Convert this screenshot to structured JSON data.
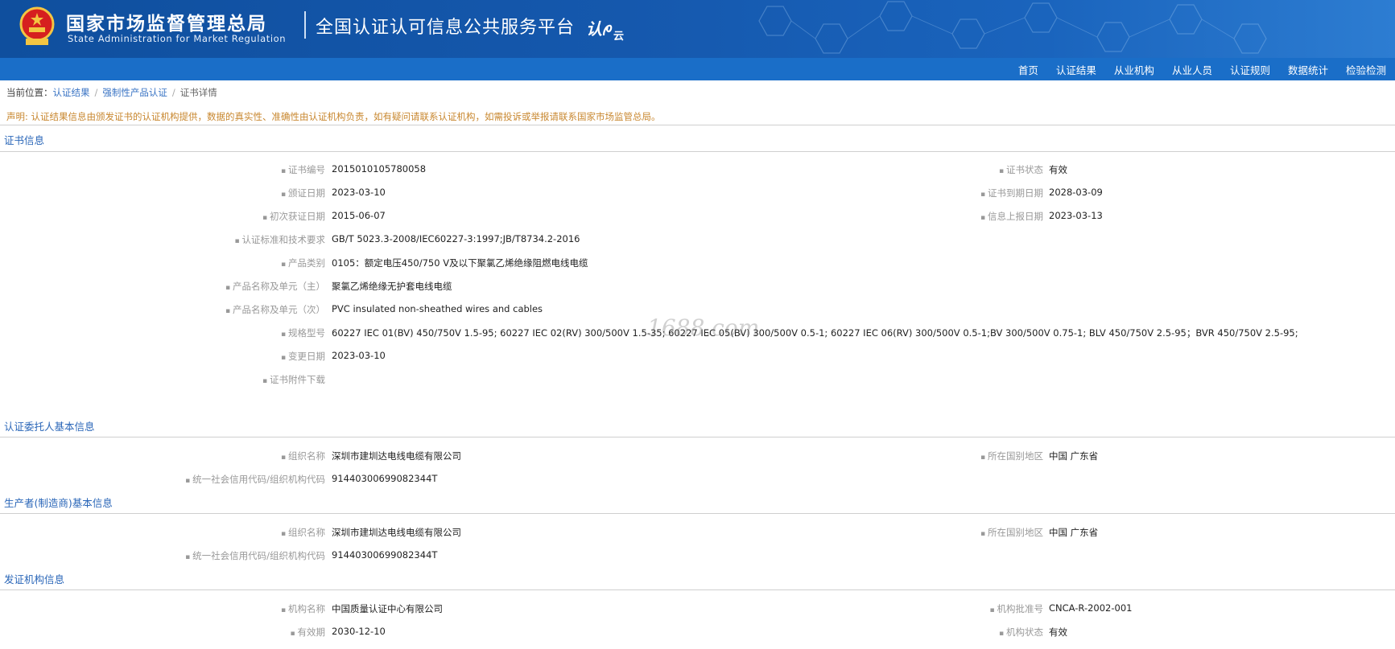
{
  "header": {
    "org_name": "国家市场监督管理总局",
    "org_name_en": "State Administration  for  Market Regulation",
    "platform_title": "全国认证认可信息公共服务平台",
    "logo_text": "认",
    "logo_sub": "云"
  },
  "nav": {
    "items": [
      "首页",
      "认证结果",
      "从业机构",
      "从业人员",
      "认证规则",
      "数据统计",
      "检验检测"
    ]
  },
  "breadcrumb": {
    "prefix": "当前位置：",
    "items": [
      "认证结果",
      "强制性产品认证"
    ],
    "current": "证书详情"
  },
  "notice": "声明: 认证结果信息由颁发证书的认证机构提供，数据的真实性、准确性由认证机构负责，如有疑问请联系认证机构，如需投诉或举报请联系国家市场监管总局。",
  "watermark": "1688.com",
  "sections": {
    "certificate": {
      "title": "证书信息",
      "left": [
        {
          "label": "证书编号",
          "value": "2015010105780058"
        },
        {
          "label": "颁证日期",
          "value": "2023-03-10"
        },
        {
          "label": "初次获证日期",
          "value": "2015-06-07"
        },
        {
          "label": "认证标准和技术要求",
          "value": "GB/T 5023.3-2008/IEC60227-3:1997;JB/T8734.2-2016"
        },
        {
          "label": "产品类别",
          "value": "0105：额定电压450/750 V及以下聚氯乙烯绝缘阻燃电线电缆"
        },
        {
          "label": "产品名称及单元（主）",
          "value": "聚氯乙烯绝缘无护套电线电缆"
        },
        {
          "label": "产品名称及单元（次）",
          "value": "PVC insulated non-sheathed wires and cables"
        },
        {
          "label": "规格型号",
          "value": "60227 IEC 01(BV) 450/750V 1.5-95; 60227 IEC 02(RV) 300/500V 1.5-35; 60227 IEC 05(BV) 300/500V 0.5-1; 60227 IEC 06(RV) 300/500V 0.5-1;BV 300/500V 0.75-1; BLV 450/750V 2.5-95；BVR 450/750V 2.5-95;"
        },
        {
          "label": "变更日期",
          "value": "2023-03-10"
        },
        {
          "label": "证书附件下载",
          "value": ""
        }
      ],
      "right": [
        {
          "label": "证书状态",
          "value": "有效"
        },
        {
          "label": "证书到期日期",
          "value": "2028-03-09"
        },
        {
          "label": "信息上报日期",
          "value": "2023-03-13"
        }
      ]
    },
    "applicant": {
      "title": "认证委托人基本信息",
      "left": [
        {
          "label": "组织名称",
          "value": "深圳市建圳达电线电缆有限公司"
        },
        {
          "label": "统一社会信用代码/组织机构代码",
          "value": "91440300699082344T"
        }
      ],
      "right": [
        {
          "label": "所在国别地区",
          "value": "中国 广东省"
        }
      ]
    },
    "manufacturer": {
      "title": "生产者(制造商)基本信息",
      "left": [
        {
          "label": "组织名称",
          "value": "深圳市建圳达电线电缆有限公司"
        },
        {
          "label": "统一社会信用代码/组织机构代码",
          "value": "91440300699082344T"
        }
      ],
      "right": [
        {
          "label": "所在国别地区",
          "value": "中国 广东省"
        }
      ]
    },
    "issuer": {
      "title": "发证机构信息",
      "left": [
        {
          "label": "机构名称",
          "value": "中国质量认证中心有限公司"
        },
        {
          "label": "有效期",
          "value": "2030-12-10"
        }
      ],
      "right": [
        {
          "label": "机构批准号",
          "value": "CNCA-R-2002-001"
        },
        {
          "label": "机构状态",
          "value": "有效"
        }
      ]
    }
  }
}
